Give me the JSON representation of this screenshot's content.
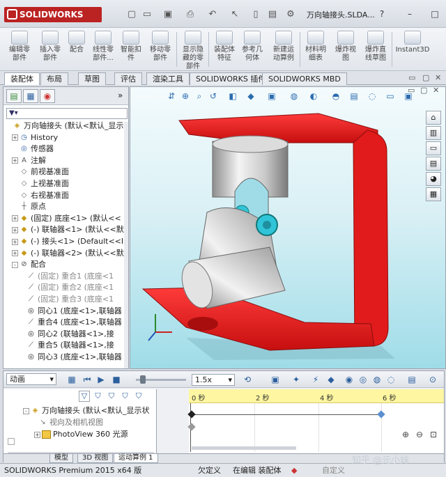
{
  "titlebar": {
    "brand": "SOLIDWORKS",
    "window_title": "万向轴接头.SLDA...",
    "help": "?",
    "minimize": "–",
    "restore": "□"
  },
  "ribbon": {
    "buttons": [
      {
        "label": "编辑零\n部件"
      },
      {
        "label": "插入零\n部件"
      },
      {
        "label": "配合"
      },
      {
        "label": "线性零\n部件..."
      },
      {
        "label": "智能扣\n件"
      },
      {
        "label": "移动零\n部件"
      },
      {
        "label": "显示隐\n藏的零\n部件"
      },
      {
        "label": "装配体\n特征"
      },
      {
        "label": "参考几\n何体"
      },
      {
        "label": "新建运\n动算例"
      },
      {
        "label": "材料明\n细表"
      },
      {
        "label": "爆炸视\n图"
      },
      {
        "label": "爆炸直\n线草图"
      },
      {
        "label": "Instant3D"
      }
    ]
  },
  "tabs": [
    "装配体",
    "布局",
    "草图",
    "评估",
    "渲染工具",
    "SOLIDWORKS 插件",
    "SOLIDWORKS MBD"
  ],
  "feature_tree": {
    "filter_icon": "filter-icon",
    "items": [
      {
        "label": "万向轴接头  (默认<默认_显示",
        "icon": "assembly-icon",
        "exp": "",
        "indent": 0
      },
      {
        "label": "History",
        "icon": "history-icon",
        "exp": "+",
        "indent": 1
      },
      {
        "label": "传感器",
        "icon": "sensor-icon",
        "exp": "",
        "indent": 1
      },
      {
        "label": "注解",
        "icon": "annotation-icon",
        "exp": "+",
        "indent": 1
      },
      {
        "label": "前视基准面",
        "icon": "plane-icon",
        "exp": "",
        "indent": 1
      },
      {
        "label": "上视基准面",
        "icon": "plane-icon",
        "exp": "",
        "indent": 1
      },
      {
        "label": "右视基准面",
        "icon": "plane-icon",
        "exp": "",
        "indent": 1
      },
      {
        "label": "原点",
        "icon": "origin-icon",
        "exp": "",
        "indent": 1
      },
      {
        "label": "(固定) 底座<1> (默认<<",
        "icon": "part-icon",
        "exp": "+",
        "indent": 1
      },
      {
        "label": "(-) 联轴器<1> (默认<<默",
        "icon": "part-icon",
        "exp": "+",
        "indent": 1
      },
      {
        "label": "(-) 接头<1> (Default<<I",
        "icon": "part-icon",
        "exp": "+",
        "indent": 1
      },
      {
        "label": "(-) 联轴器<2> (默认<<默",
        "icon": "part-icon",
        "exp": "+",
        "indent": 1
      },
      {
        "label": "配合",
        "icon": "mates-icon",
        "exp": "-",
        "indent": 1
      },
      {
        "label": "(固定) 重合1 (底座<1",
        "icon": "coincident-icon",
        "exp": "",
        "indent": 2,
        "dim": true
      },
      {
        "label": "(固定) 重合2 (底座<1",
        "icon": "coincident-icon",
        "exp": "",
        "indent": 2,
        "dim": true
      },
      {
        "label": "(固定) 重合3 (底座<1",
        "icon": "coincident-icon",
        "exp": "",
        "indent": 2,
        "dim": true
      },
      {
        "label": "同心1 (底座<1>,联轴器",
        "icon": "concentric-icon",
        "exp": "",
        "indent": 2
      },
      {
        "label": "重合4 (底座<1>,联轴器",
        "icon": "coincident-icon",
        "exp": "",
        "indent": 2
      },
      {
        "label": "同心2 (联轴器<1>,接",
        "icon": "concentric-icon",
        "exp": "",
        "indent": 2
      },
      {
        "label": "重合5 (联轴器<1>,接",
        "icon": "coincident-icon",
        "exp": "",
        "indent": 2
      },
      {
        "label": "同心3 (底座<1>,联轴器",
        "icon": "concentric-icon",
        "exp": "",
        "indent": 2
      }
    ]
  },
  "motion": {
    "study_type": "动画",
    "speed": "1.5x",
    "tree": [
      {
        "label": "万向轴接头  (默认<默认_显示状",
        "exp": "-"
      },
      {
        "label": "视向及相机视图",
        "exp": ""
      },
      {
        "label": "PhotoView 360 光源",
        "exp": "+"
      }
    ],
    "ticks": [
      "0 秒",
      "2 秒",
      "4 秒",
      "6 秒"
    ]
  },
  "bottom_tabs": [
    "模型",
    "3D 视图",
    "运动算例 1"
  ],
  "status": {
    "product": "SOLIDWORKS Premium 2015 x64 版",
    "defined": "欠定义",
    "editing": "在编辑 装配体",
    "custom": "自定义"
  },
  "watermark": "知乎 @元小妹",
  "colors": {
    "bracket": "#e11b1b",
    "coupling": "#c9c9c9",
    "pin": "#30c4d8",
    "accent": "#2b5f9e"
  }
}
